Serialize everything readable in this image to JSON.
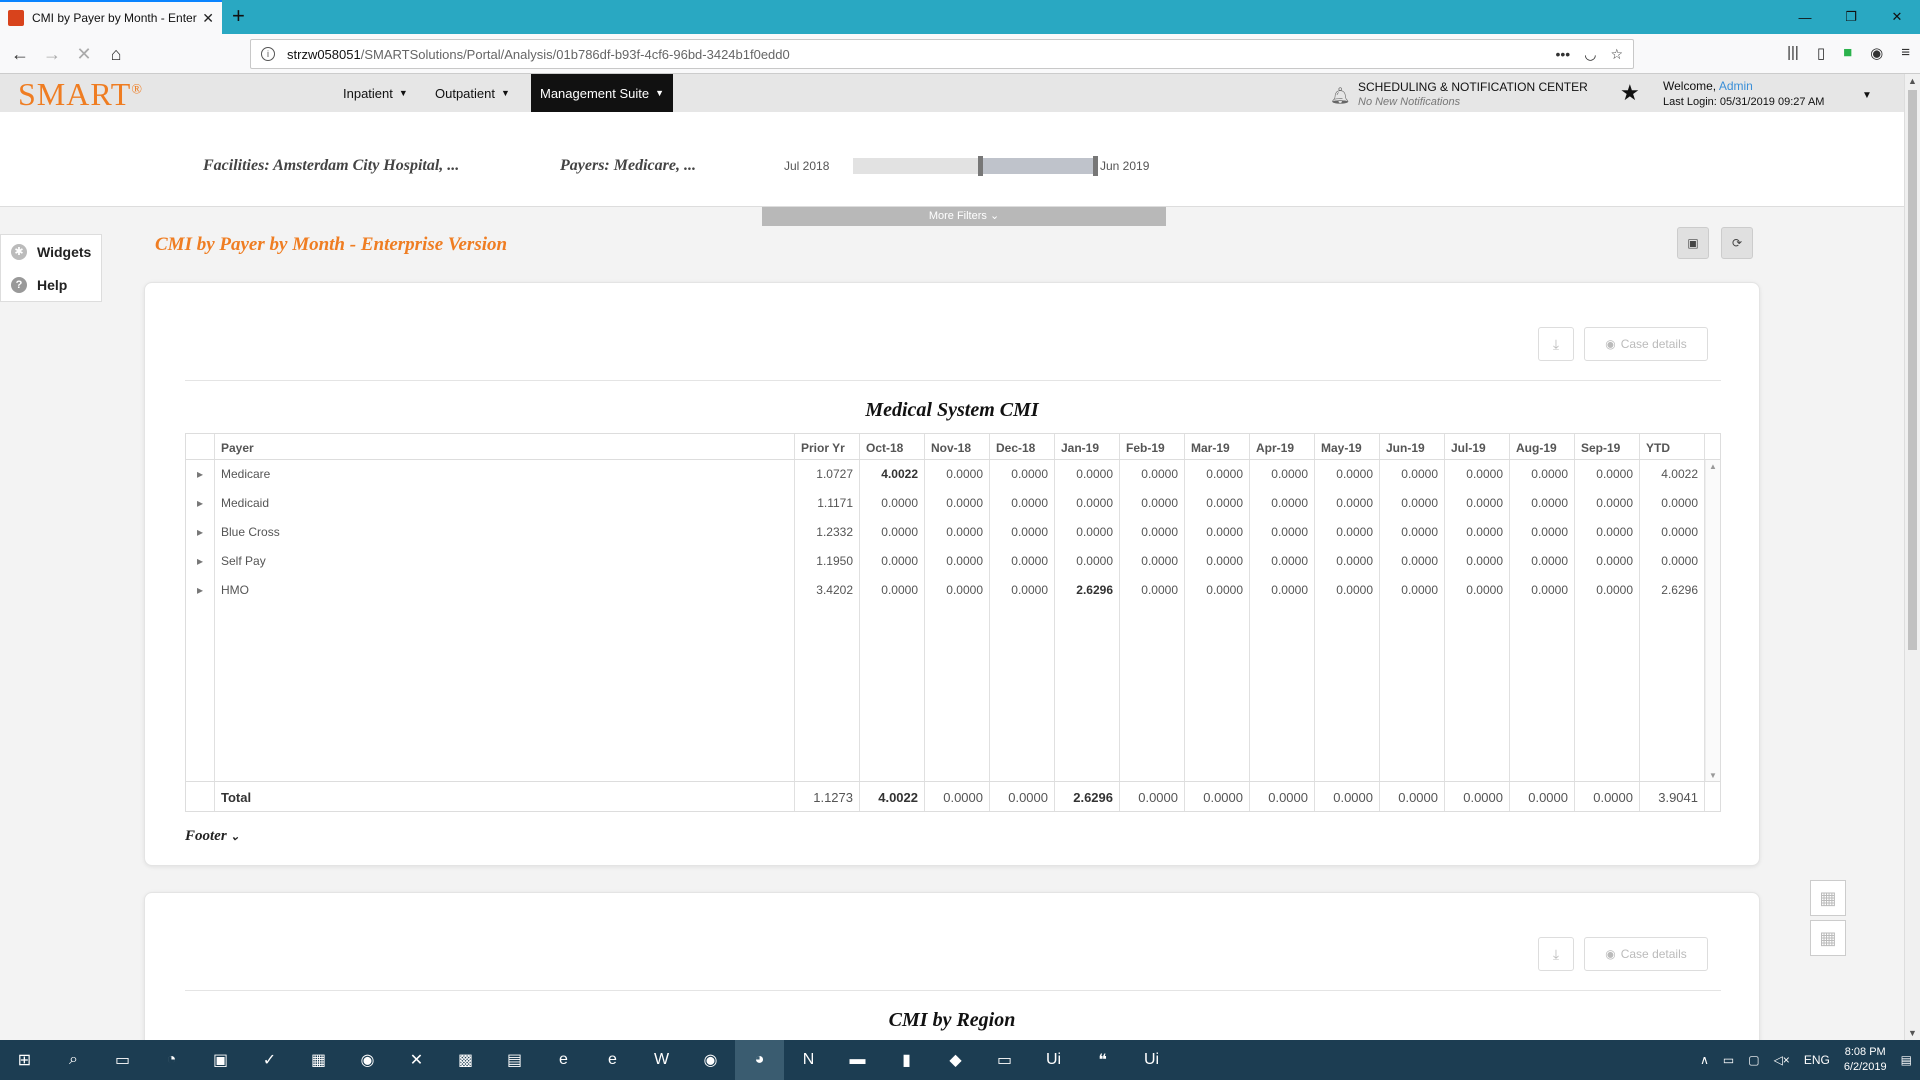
{
  "browser": {
    "tab_title": "CMI by Payer by Month - Enter",
    "url_host": "strzw058051",
    "url_path": "/SMARTSolutions/Portal/Analysis/01b786df-b93f-4cf6-96bd-3424b1f0edd0"
  },
  "app": {
    "logo": "SMART",
    "logo_mark": "®",
    "menus": [
      "Inpatient",
      "Outpatient",
      "Management Suite"
    ],
    "notif_title": "SCHEDULING & NOTIFICATION CENTER",
    "notif_sub": "No New Notifications",
    "welcome": "Welcome,",
    "user": "Admin",
    "last_login": "Last Login: 05/31/2019 09:27 AM"
  },
  "filters": {
    "facilities": "Facilities: Amsterdam City Hospital, ...",
    "payers": "Payers: Medicare, ...",
    "range_start": "Jul 2018",
    "range_end": "Jun 2019",
    "more": "More Filters"
  },
  "side": {
    "widgets": "Widgets",
    "help": "Help"
  },
  "page_title": "CMI by Payer by Month - Enterprise Version",
  "panel1": {
    "case_details": "Case details",
    "title": "Medical System CMI",
    "footer": "Footer",
    "columns": [
      "Payer",
      "Prior Yr",
      "Oct-18",
      "Nov-18",
      "Dec-18",
      "Jan-19",
      "Feb-19",
      "Mar-19",
      "Apr-19",
      "May-19",
      "Jun-19",
      "Jul-19",
      "Aug-19",
      "Sep-19",
      "YTD"
    ],
    "rows": [
      [
        "Medicare",
        "1.0727",
        "4.0022",
        "0.0000",
        "0.0000",
        "0.0000",
        "0.0000",
        "0.0000",
        "0.0000",
        "0.0000",
        "0.0000",
        "0.0000",
        "0.0000",
        "0.0000",
        "4.0022"
      ],
      [
        "Medicaid",
        "1.1171",
        "0.0000",
        "0.0000",
        "0.0000",
        "0.0000",
        "0.0000",
        "0.0000",
        "0.0000",
        "0.0000",
        "0.0000",
        "0.0000",
        "0.0000",
        "0.0000",
        "0.0000"
      ],
      [
        "Blue Cross",
        "1.2332",
        "0.0000",
        "0.0000",
        "0.0000",
        "0.0000",
        "0.0000",
        "0.0000",
        "0.0000",
        "0.0000",
        "0.0000",
        "0.0000",
        "0.0000",
        "0.0000",
        "0.0000"
      ],
      [
        "Self Pay",
        "1.1950",
        "0.0000",
        "0.0000",
        "0.0000",
        "0.0000",
        "0.0000",
        "0.0000",
        "0.0000",
        "0.0000",
        "0.0000",
        "0.0000",
        "0.0000",
        "0.0000",
        "0.0000"
      ],
      [
        "HMO",
        "3.4202",
        "0.0000",
        "0.0000",
        "0.0000",
        "2.6296",
        "0.0000",
        "0.0000",
        "0.0000",
        "0.0000",
        "0.0000",
        "0.0000",
        "0.0000",
        "0.0000",
        "2.6296"
      ]
    ],
    "total": [
      "Total",
      "1.1273",
      "4.0022",
      "0.0000",
      "0.0000",
      "2.6296",
      "0.0000",
      "0.0000",
      "0.0000",
      "0.0000",
      "0.0000",
      "0.0000",
      "0.0000",
      "0.0000",
      "3.9041"
    ]
  },
  "panel2": {
    "case_details": "Case details",
    "title": "CMI by Region"
  },
  "taskbar": {
    "lang": "ENG",
    "time": "8:08 PM",
    "date": "6/2/2019"
  }
}
